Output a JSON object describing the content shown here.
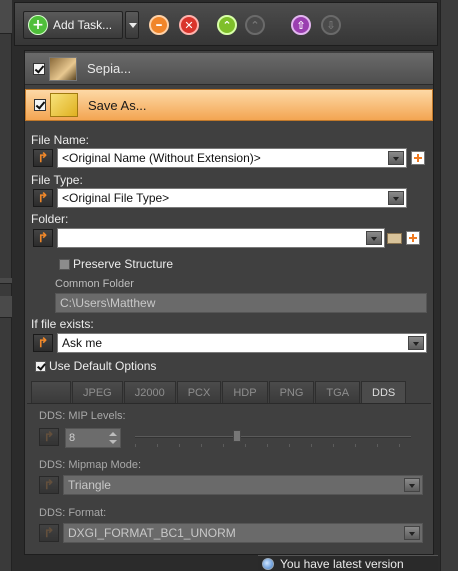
{
  "toolbar": {
    "add_task_label": "Add Task...",
    "icons": [
      "plus-circle-icon",
      "minus-circle-icon",
      "delete-circle-icon",
      "move-up-icon",
      "move-down-icon",
      "move-top-icon",
      "move-bottom-icon"
    ]
  },
  "tasks": [
    {
      "title": "Sepia...",
      "checked": true,
      "icon": "sepia-icon"
    },
    {
      "title": "Save As...",
      "checked": true,
      "icon": "save-as-icon"
    }
  ],
  "form": {
    "file_name_label": "File Name:",
    "file_name_value": "<Original Name (Without Extension)>",
    "file_type_label": "File Type:",
    "file_type_value": "<Original File Type>",
    "folder_label": "Folder:",
    "folder_value": "",
    "preserve_structure_label": "Preserve Structure",
    "preserve_structure_checked": false,
    "common_folder_label": "Common Folder",
    "common_folder_value": "C:\\Users\\Matthew",
    "if_exists_label": "If file exists:",
    "if_exists_value": "Ask me",
    "use_default_label": "Use Default Options",
    "use_default_checked": true
  },
  "format_tabs": [
    "",
    "JPEG",
    "J2000",
    "PCX",
    "HDP",
    "PNG",
    "TGA",
    "DDS"
  ],
  "active_tab": "DDS",
  "dds": {
    "mip_label": "DDS: MIP Levels:",
    "mip_value": "8",
    "mipmap_mode_label": "DDS: Mipmap Mode:",
    "mipmap_mode_value": "Triangle",
    "format_label": "DDS: Format:",
    "format_value": "DXGI_FORMAT_BC1_UNORM"
  },
  "status": {
    "message": "You have latest version"
  },
  "colors": {
    "accent_orange": "#f3a552",
    "panel_bg": "#404040"
  }
}
